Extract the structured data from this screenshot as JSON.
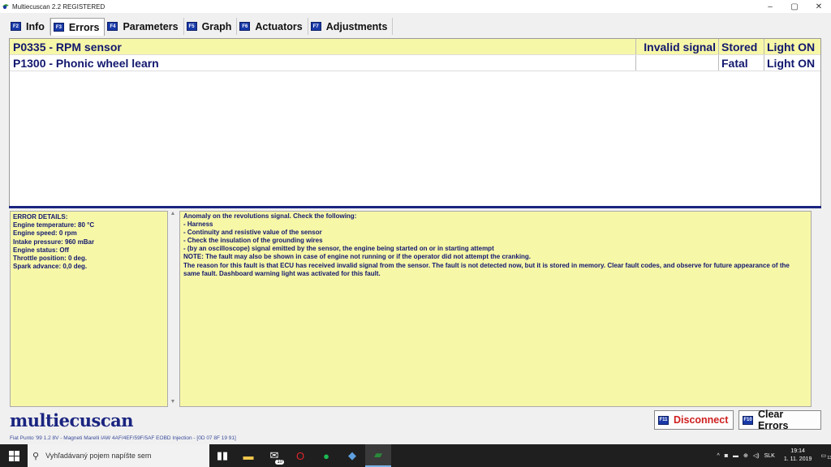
{
  "window": {
    "title": "Multiecuscan 2.2 REGISTERED",
    "minimize": "–",
    "maximize": "▢",
    "close": "✕"
  },
  "tabs": [
    {
      "key": "F2",
      "label": "Info"
    },
    {
      "key": "F3",
      "label": "Errors"
    },
    {
      "key": "F4",
      "label": "Parameters"
    },
    {
      "key": "F5",
      "label": "Graph"
    },
    {
      "key": "F6",
      "label": "Actuators"
    },
    {
      "key": "F7",
      "label": "Adjustments"
    }
  ],
  "errors": [
    {
      "code": "P0335 - RPM sensor",
      "c2": "Invalid signal",
      "c3": "Stored",
      "c4": "Light ON"
    },
    {
      "code": "P1300 - Phonic wheel learn",
      "c2": "",
      "c3": "Fatal",
      "c4": "Light ON"
    }
  ],
  "details": {
    "lines": [
      "ERROR DETAILS:",
      "Engine temperature: 80 °C",
      "Engine speed: 0 rpm",
      "Intake pressure: 960 mBar",
      "Engine status: Off",
      "Throttle position: 0 deg.",
      "Spark advance: 0,0 deg."
    ]
  },
  "description": {
    "lines": [
      "Anomaly on the revolutions signal. Check the following:",
      "- Harness",
      "- Continuity and resistive value of the sensor",
      "- Check the insulation of the grounding wires",
      "- (by an oscilloscope) signal emitted by the sensor, the engine being started on or in starting attempt",
      "NOTE: The fault may also be shown in case of engine not running or if the operator did not attempt the cranking.",
      "The reason for this fault is that ECU has received invalid signal from the sensor. The fault is not detected now, but it is stored in memory. Clear fault codes, and observe for future appearance of the same fault. Dashboard warning light was activated for this fault."
    ]
  },
  "logo": "multiecuscan",
  "buttons": {
    "disconnect": {
      "key": "F11",
      "label": "Disconnect"
    },
    "clear": {
      "key": "F10",
      "label": "Clear Errors"
    }
  },
  "status": "Fiat Punto '99 1.2 8V - Magneti Marelli IAW 4AF/4EF/59F/5AF EOBD Injection - [0D 07 8F 19 91]",
  "taskbar": {
    "search_placeholder": "Vyhľadávaný pojem napíšte sem",
    "language": "SLK",
    "time": "19:14",
    "date": "1. 11. 2019",
    "notification_count": "13",
    "mail_badge": "10"
  },
  "colors": {
    "selected_row": "#f7f7a8",
    "text_blue": "#12186e",
    "disconnect_red": "#d02020"
  }
}
